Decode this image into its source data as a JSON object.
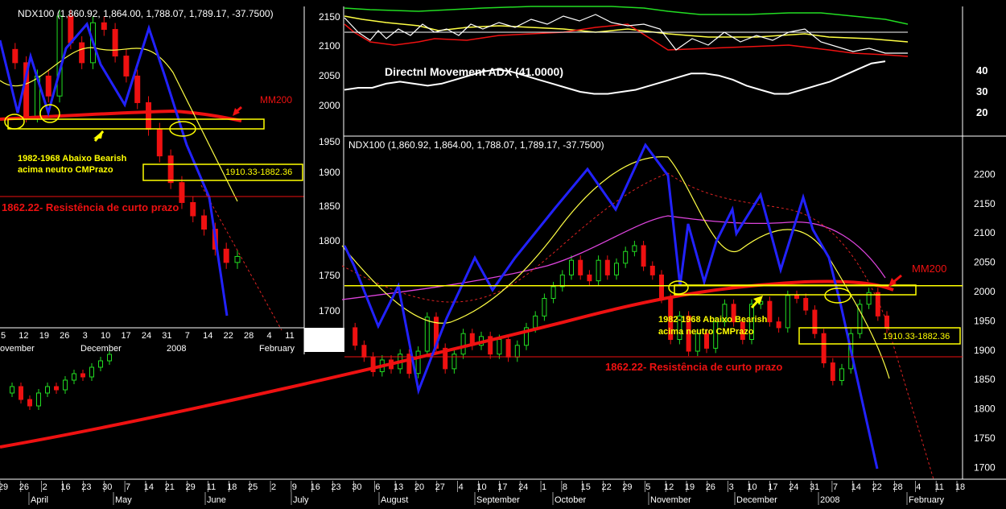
{
  "colors": {
    "background": "#000000",
    "up": "#22dd22",
    "down": "#ee1111",
    "blue_trend": "#2222ff",
    "ma_fast": "#ffff44",
    "ma_mid": "#dd2222",
    "ma_slow": "#dd44dd",
    "mm200": "#ee1111",
    "support": "#ffff00",
    "adx": "#ffffff",
    "dmi_plus": "#22dd22",
    "dmi_minus": "#ee1111",
    "dmi_signal": "#ffff44"
  },
  "chart_data": [
    {
      "type": "line",
      "name": "dmi-adx-panel",
      "title": "Directnl Movement ADX (41.0000)",
      "ylabel_left_ticks": [
        "2150",
        "2100",
        "2050",
        "2000"
      ],
      "ylabel_right_ticks": [
        "40",
        "30",
        "20"
      ],
      "adx_ylim": [
        10,
        45
      ],
      "adx_values": [
        30,
        31,
        31,
        33,
        34,
        33,
        32,
        33,
        35,
        37,
        39,
        40,
        39,
        37,
        35,
        33,
        31,
        29,
        28,
        28,
        29,
        30,
        32,
        34,
        36,
        38,
        38,
        37,
        35,
        32,
        30,
        28,
        28,
        30,
        32,
        34,
        37,
        40,
        43,
        44
      ]
    },
    {
      "type": "bar",
      "name": "main-price-chart",
      "title": "NDX100 (1,860.92, 1,864.00, 1,788.07, 1,789.17, -37.7500)",
      "y_left_ticks": [
        "1950",
        "1900",
        "1850",
        "1800",
        "1750",
        "1700"
      ],
      "y_right_ticks": [
        "2200",
        "2150",
        "2100",
        "2050",
        "2000",
        "1950",
        "1900",
        "1850",
        "1800",
        "1750",
        "1700"
      ],
      "y_right_range": [
        1680,
        2250
      ],
      "x_day_ticks": [
        "29",
        "26",
        "2",
        "16",
        "23",
        "30",
        "7",
        "14",
        "21",
        "29",
        "11",
        "18",
        "25",
        "2",
        "9",
        "16",
        "23",
        "30",
        "6",
        "13",
        "20",
        "27",
        "4",
        "10",
        "17",
        "24",
        "1",
        "8",
        "15",
        "22",
        "29",
        "5",
        "12",
        "19",
        "26",
        "3",
        "10",
        "17",
        "24",
        "31",
        "7",
        "14",
        "22",
        "28",
        "4",
        "11",
        "18"
      ],
      "x_month_ticks": [
        "April",
        "May",
        "June",
        "July",
        "August",
        "September",
        "October",
        "November",
        "December",
        "2008",
        "February"
      ],
      "close_path": [
        1790,
        1760,
        1740,
        1715,
        1735,
        1720,
        1745,
        1712,
        1750,
        1808,
        1755,
        1720,
        1745,
        1780,
        1760,
        1775,
        1745,
        1770,
        1740,
        1760,
        1790,
        1810,
        1840,
        1860,
        1880,
        1905,
        1880,
        1870,
        1905,
        1880,
        1900,
        1920,
        1930,
        1895,
        1880,
        1840,
        1770,
        1810,
        1750,
        1780,
        1755,
        1800,
        1830,
        1800,
        1770,
        1830,
        1835,
        1800,
        1790,
        1845,
        1840,
        1820,
        1780,
        1730,
        1700,
        1720,
        1780,
        1830,
        1850,
        1810,
        1789
      ],
      "annotations": {
        "mm200": "MM200",
        "support_note_line1": "1982-1968 Abaixo Bearish",
        "support_note_line2": "acima neutro CMPrazo",
        "zone_label": "1910.33-1882.36",
        "resistance_label": "1862.22- Resistência de curto prazo"
      }
    },
    {
      "type": "bar",
      "name": "inset-price-chart",
      "title": "NDX100 (1,860.92, 1,864.00, 1,788.07, 1,789.17, -37.7500)",
      "y_ticks": [
        "2150",
        "2100",
        "2050",
        "2000",
        "1950",
        "1900",
        "1850",
        "1800",
        "1750",
        "1700"
      ],
      "x_day_ticks": [
        "5",
        "12",
        "19",
        "26",
        "3",
        "10",
        "17",
        "24",
        "31",
        "7",
        "14",
        "22",
        "28",
        "4",
        "11"
      ],
      "x_month_ticks": [
        "ovember",
        "December",
        "2008",
        "February"
      ],
      "close_path": [
        2100,
        2080,
        2000,
        2060,
        2030,
        2150,
        2110,
        2080,
        2140,
        2130,
        2090,
        2060,
        2020,
        1980,
        1940,
        1900,
        1870,
        1850,
        1830,
        1800,
        1780,
        1789
      ],
      "annotations": {
        "mm200": "MM200",
        "support_note_line1": "1982-1968 Abaixo Bearish",
        "support_note_line2": "acima neutro CMPrazo",
        "zone_label": "1910.33-1882.36",
        "resistance_label": "1862.22- Resistência de curto prazo"
      }
    }
  ]
}
